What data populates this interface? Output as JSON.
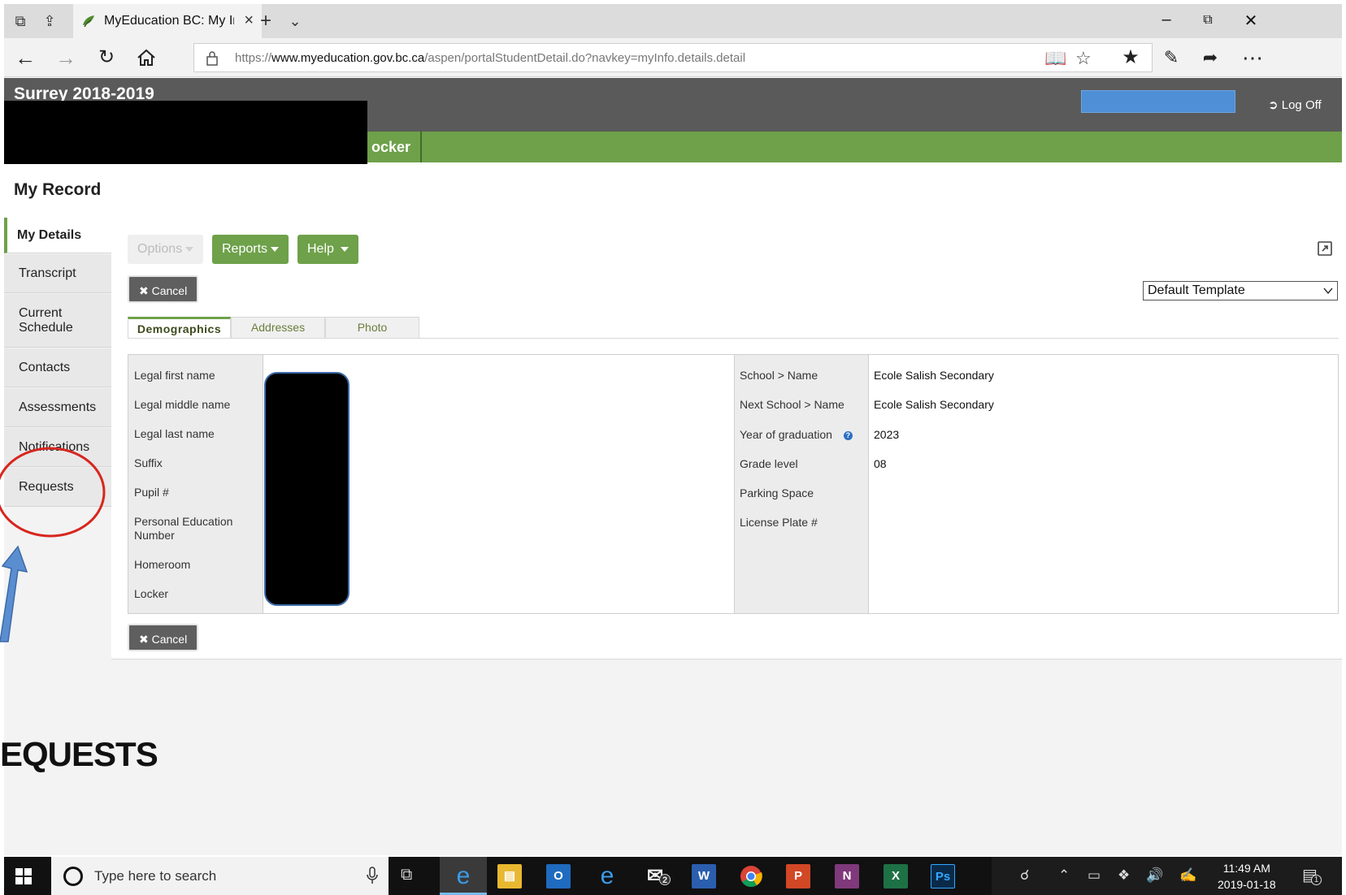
{
  "browser": {
    "tab_title": "MyEducation BC: My Inf",
    "url_prefix": "https://",
    "url_host": "www.myeducation.gov.bc.ca",
    "url_path": "/aspen/portalStudentDetail.do?navkey=myInfo.details.detail"
  },
  "header": {
    "district": "Surrey 2018-2019",
    "log_off": "Log Off",
    "nav_tab_visible": "ocker"
  },
  "page": {
    "title": "My Record"
  },
  "sidebar": {
    "items": [
      {
        "label": "My Details"
      },
      {
        "label": "Transcript"
      },
      {
        "label": "Current Schedule"
      },
      {
        "label": "Contacts"
      },
      {
        "label": "Assessments"
      },
      {
        "label": "Notifications"
      },
      {
        "label": "Requests"
      }
    ]
  },
  "toolbar": {
    "options": "Options",
    "reports": "Reports",
    "help": "Help",
    "cancel": "Cancel"
  },
  "template_select": {
    "selected": "Default Template"
  },
  "subtabs": [
    {
      "label": "Demographics",
      "active": true
    },
    {
      "label": "Addresses",
      "active": false
    },
    {
      "label": "Photo",
      "active": false
    }
  ],
  "form": {
    "left_labels": [
      "Legal first name",
      "Legal middle name",
      "Legal last name",
      "Suffix",
      "Pupil #",
      "Personal Education Number",
      "Homeroom",
      "Locker"
    ],
    "right_fields": [
      {
        "label": "School > Name",
        "value": "Ecole Salish Secondary"
      },
      {
        "label": "Next School > Name",
        "value": "Ecole Salish Secondary"
      },
      {
        "label": "Year of graduation",
        "value": "2023"
      },
      {
        "label": "Grade level",
        "value": "08"
      },
      {
        "label": "Parking Space",
        "value": ""
      },
      {
        "label": "License Plate #",
        "value": ""
      }
    ]
  },
  "annotation": {
    "caption": "EQUESTS"
  },
  "taskbar": {
    "search_placeholder": "Type here to search",
    "time": "11:49 AM",
    "date": "2019-01-18",
    "mail_badge": "2",
    "notification_badge": "1"
  },
  "colors": {
    "green_accent": "#6ea14a",
    "header_gray": "#5a5a5a",
    "annotation_red": "#d7261e",
    "annotation_arrow_blue": "#5a8ed0"
  }
}
